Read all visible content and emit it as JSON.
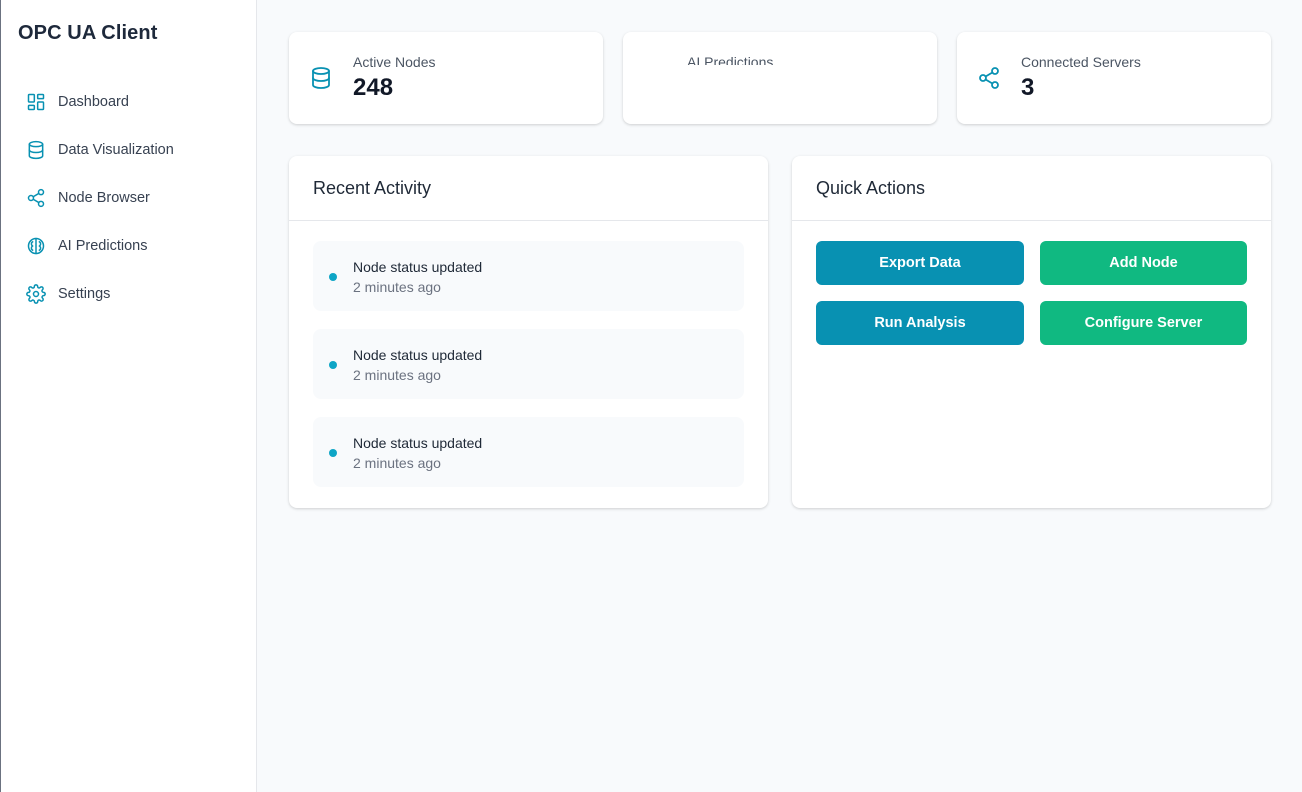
{
  "app": {
    "title": "OPC UA Client"
  },
  "sidebar": {
    "items": [
      {
        "label": "Dashboard",
        "icon": "dashboard-icon"
      },
      {
        "label": "Data Visualization",
        "icon": "database-icon"
      },
      {
        "label": "Node Browser",
        "icon": "share-icon"
      },
      {
        "label": "AI Predictions",
        "icon": "brain-icon"
      },
      {
        "label": "Settings",
        "icon": "gear-icon"
      }
    ]
  },
  "stats": [
    {
      "label": "Active Nodes",
      "value": "248",
      "icon": "database-icon"
    },
    {
      "label": "AI Predictions",
      "value": "",
      "icon": ""
    },
    {
      "label": "Connected Servers",
      "value": "3",
      "icon": "share-icon"
    }
  ],
  "recent_activity": {
    "title": "Recent Activity",
    "items": [
      {
        "title": "Node status updated",
        "time": "2 minutes ago"
      },
      {
        "title": "Node status updated",
        "time": "2 minutes ago"
      },
      {
        "title": "Node status updated",
        "time": "2 minutes ago"
      }
    ]
  },
  "quick_actions": {
    "title": "Quick Actions",
    "buttons": [
      {
        "label": "Export Data",
        "color": "#0891b2"
      },
      {
        "label": "Add Node",
        "color": "#10b981"
      },
      {
        "label": "Run Analysis",
        "color": "#0891b2"
      },
      {
        "label": "Configure Server",
        "color": "#10b981"
      }
    ]
  },
  "colors": {
    "accent": "#0891b2",
    "success": "#10b981",
    "dot": "#0ea5c6"
  }
}
